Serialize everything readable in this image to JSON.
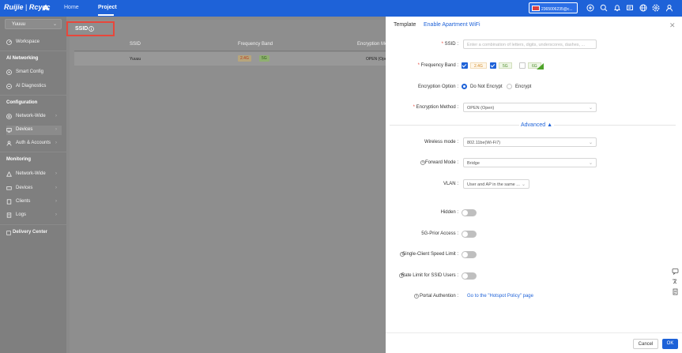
{
  "header": {
    "brand": "Ruijie",
    "brand_sep": " | ",
    "brand_sub": "Rcycc",
    "tabs": [
      {
        "label": "Home"
      },
      {
        "label": "Project"
      }
    ],
    "active_tab": "Project",
    "account_label": "2365006235@c...",
    "icons": [
      "add-icon",
      "search-icon",
      "bell-icon",
      "message-icon",
      "globe-icon",
      "settings-icon",
      "user-icon"
    ]
  },
  "sidebar": {
    "org": "Yuuuu",
    "workspace": "Workspace",
    "sections": [
      {
        "title": "AI Networking",
        "items": [
          {
            "label": "Smart Config",
            "icon": "smart-config-icon"
          },
          {
            "label": "AI Diagnostics",
            "icon": "ai-diagnostics-icon"
          }
        ]
      },
      {
        "title": "Configuration",
        "items": [
          {
            "label": "Network-Wide",
            "icon": "network-icon"
          },
          {
            "label": "Devices",
            "icon": "devices-icon"
          },
          {
            "label": "Auth & Accounts",
            "icon": "auth-icon"
          }
        ]
      },
      {
        "title": "Monitoring",
        "items": [
          {
            "label": "Network-Wide",
            "icon": "network-icon"
          },
          {
            "label": "Devices",
            "icon": "devices-icon"
          },
          {
            "label": "Clients",
            "icon": "clients-icon"
          },
          {
            "label": "Logs",
            "icon": "logs-icon"
          }
        ]
      }
    ],
    "delivery": "Delivery Center"
  },
  "main": {
    "title": "SSID",
    "columns": [
      "SSID",
      "Frequency Band",
      "Encryption Me"
    ],
    "rows": [
      {
        "ssid": "Yuuuu",
        "bands": [
          "2.4G",
          "5G"
        ],
        "encryption": "OPEN (Open"
      }
    ]
  },
  "drawer": {
    "tabs": [
      "Template",
      "Enable Apartment WiFi"
    ],
    "ssid": {
      "label": "SSID",
      "placeholder": "Enter a combination of letters, digits, underscores, dashes, ..."
    },
    "frequency_band": {
      "label": "Frequency Band",
      "options": [
        {
          "label": "2.4G",
          "checked": true
        },
        {
          "label": "5G",
          "checked": true
        },
        {
          "label": "6G",
          "checked": false
        }
      ]
    },
    "encryption_option": {
      "label": "Encryption Option",
      "options": [
        {
          "label": "Do Not Encrypt",
          "selected": true
        },
        {
          "label": "Encrypt",
          "selected": false
        }
      ]
    },
    "encryption_method": {
      "label": "Encryption Method",
      "value": "OPEN (Open)"
    },
    "advanced": "Advanced",
    "wireless_mode": {
      "label": "Wireless mode",
      "value": "802.11be(Wi-Fi7)"
    },
    "forward_mode": {
      "label": "Forward Mode",
      "value": "Bridge"
    },
    "vlan": {
      "label": "VLAN",
      "value": "User and AP in the same ..."
    },
    "toggles": [
      {
        "label": "Hidden",
        "on": false
      },
      {
        "label": "5G-Prior Access",
        "on": false
      },
      {
        "label": "Single-Client Speed Limit",
        "on": false,
        "help": true
      },
      {
        "label": "Rate Limit for SSID Users",
        "on": false,
        "help": true
      }
    ],
    "portal": {
      "label": "Portal Authention",
      "link": "Go to the \"Hotspot Policy\" page"
    },
    "cancel": "Cancel",
    "ok": "OK"
  },
  "colors": {
    "primary": "#1e62d8",
    "required": "#e8473b",
    "highlight_box": "#e8473b"
  }
}
